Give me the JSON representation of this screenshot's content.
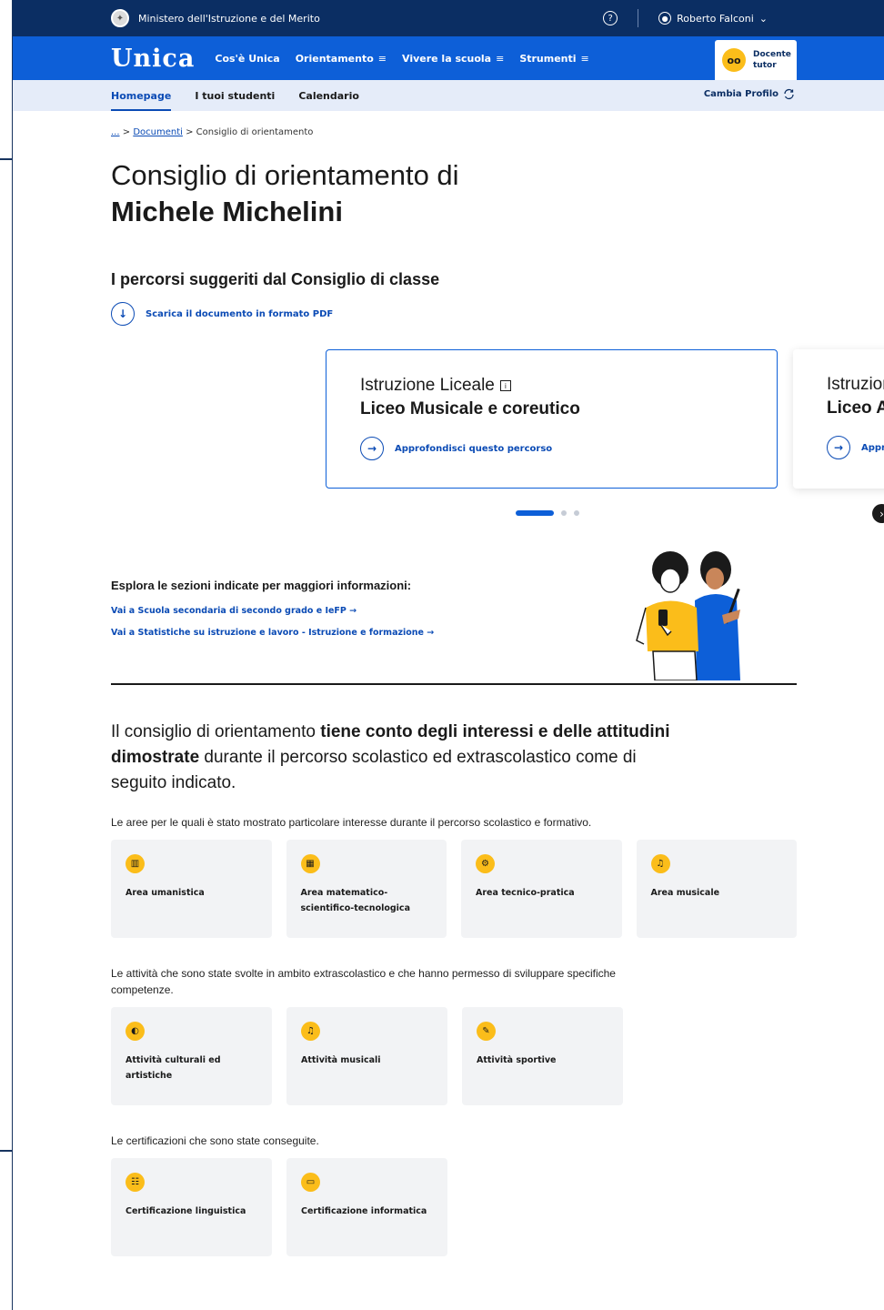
{
  "topbar": {
    "ministry": "Ministero dell'Istruzione e del Merito",
    "help_icon": "?",
    "user_name": "Roberto Falconi",
    "user_chevron": "⌄"
  },
  "mainnav": {
    "logo": "Unica",
    "items": [
      {
        "label": "Cos'è Unica",
        "menu": ""
      },
      {
        "label": "Orientamento",
        "menu": "≡"
      },
      {
        "label": "Vivere la scuola",
        "menu": "≡"
      },
      {
        "label": "Strumenti",
        "menu": "≡"
      }
    ],
    "profile_line1": "Docente",
    "profile_line2": "tutor"
  },
  "subnav": {
    "tabs": [
      "Homepage",
      "I tuoi studenti",
      "Calendario"
    ],
    "cambia": "Cambia Profilo"
  },
  "breadcrumb": {
    "home": "...",
    "sep": ">",
    "documenti": "Documenti",
    "current": "Consiglio di orientamento"
  },
  "title": {
    "line1": "Consiglio di orientamento di",
    "line2": "Michele Michelini"
  },
  "percorsi": {
    "heading": "I percorsi suggeriti dal Consiglio di classe",
    "download": "Scarica il documento in formato PDF",
    "cards": [
      {
        "category": "Istruzione Liceale",
        "name": "Liceo Musicale e coreutico",
        "link": "Approfondisci questo percorso"
      },
      {
        "category": "Istruzione Profess",
        "name": "Liceo Artistico",
        "link": "Approfondisci questo per"
      }
    ],
    "pages_total": 3,
    "page_current": 1
  },
  "explore": {
    "title": "Esplora le sezioni indicate per maggiori informazioni:",
    "links": [
      "Vai a Scuola secondaria di secondo grado e IeFP →",
      "Vai a Statistiche su istruzione e lavoro - Istruzione e formazione →"
    ]
  },
  "lead": {
    "part1": "Il consiglio di orientamento ",
    "bold": "tiene conto degli interessi e delle attitudini dimostrate",
    "part2": " durante il percorso scolastico ed extrascolastico come di seguito indicato."
  },
  "sections": {
    "aree_text": "Le aree per le quali è stato mostrato particolare interesse durante il percorso scolastico e formativo.",
    "aree": [
      "Area umanistica",
      "Area matematico-scientifico-tecnologica",
      "Area tecnico-pratica",
      "Area musicale"
    ],
    "attivita_text": "Le attività che sono state svolte in ambito extrascolastico e che hanno permesso di sviluppare specifiche competenze.",
    "attivita": [
      "Attività culturali ed artistiche",
      "Attività musicali",
      "Attività sportive"
    ],
    "cert_text": "Le certificazioni che sono state conseguite.",
    "certificazioni": [
      "Certificazione linguistica",
      "Certificazione informatica"
    ]
  },
  "colors": {
    "navy": "#0b2e63",
    "blue": "#0d5fd8",
    "link": "#0b4bb5",
    "yellow": "#fbbd1a",
    "tile_bg": "#f2f3f5"
  }
}
